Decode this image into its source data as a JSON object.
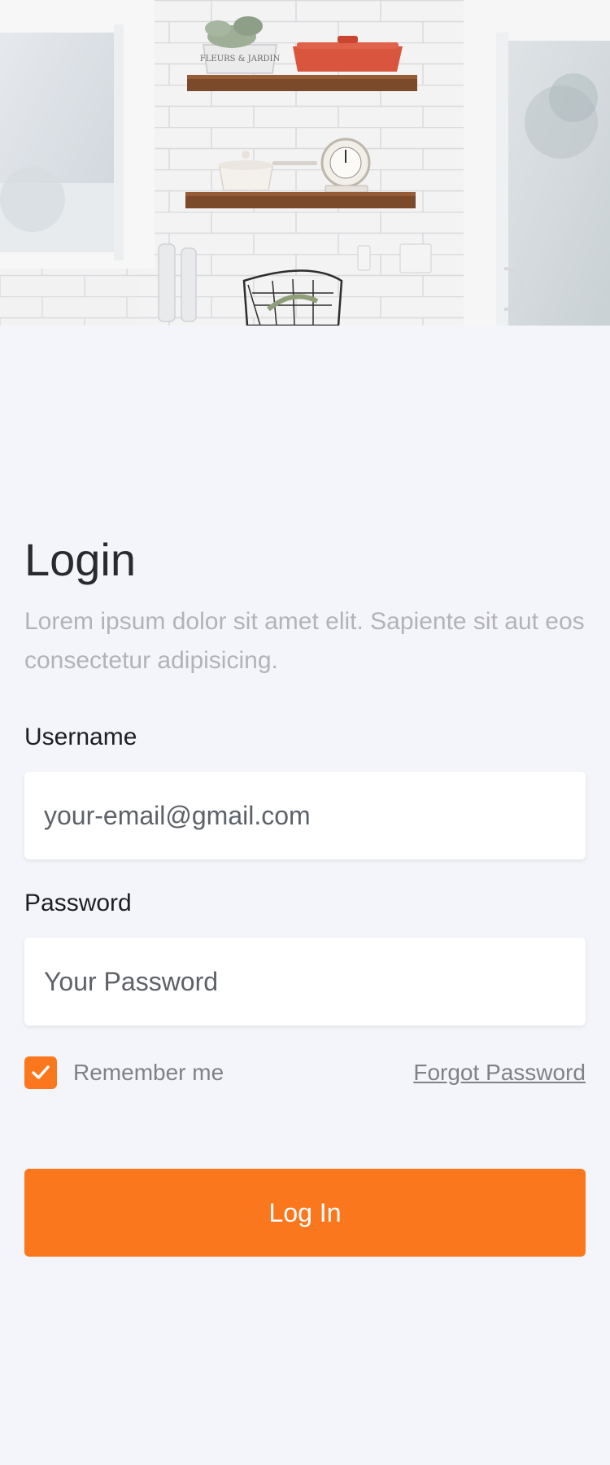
{
  "hero": {
    "image": "kitchen-shelves-photo",
    "pot_text": "FLEURS & JARDIN"
  },
  "login": {
    "title": "Login",
    "subtitle": "Lorem ipsum dolor sit amet elit. Sapiente sit aut eos consectetur adipisicing."
  },
  "username": {
    "label": "Username",
    "placeholder": "your-email@gmail.com"
  },
  "password": {
    "label": "Password",
    "placeholder": "Your Password"
  },
  "remember": {
    "label": "Remember me",
    "checked": true,
    "icon": "check-icon"
  },
  "forgot": {
    "label": "Forgot Password"
  },
  "submit": {
    "label": "Log In"
  },
  "colors": {
    "accent": "#fb771e",
    "background": "#f4f5fa",
    "title": "#2a2a2e",
    "subtitle": "#b3b3b7"
  }
}
